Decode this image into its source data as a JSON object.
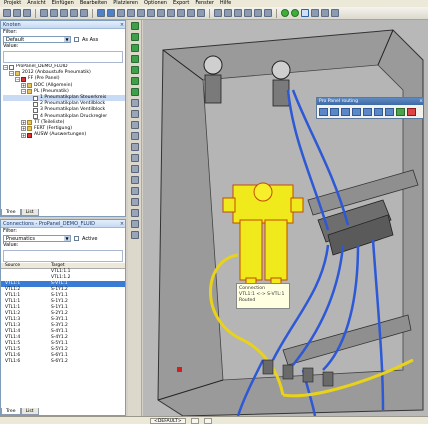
{
  "menu": [
    "Projekt",
    "Ansicht",
    "Einfügen",
    "Bearbeiten",
    "Platzieren",
    "Optionen",
    "Export",
    "Fenster",
    "Hilfe"
  ],
  "nodes_panel": {
    "title": "Knoten",
    "filter_label": "Filter:",
    "filter_value": "Default",
    "checkbox_label": "As Ass",
    "value_label": "Value:",
    "tree": [
      {
        "indent": 0,
        "toggle": "−",
        "icon": "page",
        "text": "ProPanel_DEMO_FLUID"
      },
      {
        "indent": 1,
        "toggle": "−",
        "icon": "folder",
        "text": "2012 (Anbaustufe Pneumatik)"
      },
      {
        "indent": 2,
        "toggle": "−",
        "icon": "red",
        "text": "FF (Pre Panel)"
      },
      {
        "indent": 3,
        "toggle": "+",
        "icon": "folder",
        "text": "DOC (Allgemein)"
      },
      {
        "indent": 3,
        "toggle": "−",
        "icon": "folder",
        "text": "PL (Pneumatik)"
      },
      {
        "indent": 4,
        "toggle": "",
        "icon": "page",
        "text": "1 Pneumatikplan Steuerkreis",
        "hl": true
      },
      {
        "indent": 4,
        "toggle": "",
        "icon": "page",
        "text": "2 Pneumatikplan Ventilblock"
      },
      {
        "indent": 4,
        "toggle": "",
        "icon": "page",
        "text": "3 Pneumatikplan Ventilblock"
      },
      {
        "indent": 4,
        "toggle": "",
        "icon": "page",
        "text": "4 Pneumatikplan Druckregler"
      },
      {
        "indent": 3,
        "toggle": "+",
        "icon": "folder",
        "text": "TT (Teileliste)"
      },
      {
        "indent": 3,
        "toggle": "+",
        "icon": "folder",
        "text": "FERT (Fertigung)"
      },
      {
        "indent": 3,
        "toggle": "+",
        "icon": "red",
        "text": "AUSW (Auswertungen)"
      }
    ],
    "tabs": [
      "Tree",
      "List"
    ]
  },
  "connections_panel": {
    "title": "Connections - ProPanel_DEMO_FLUID",
    "filter_label": "Filter:",
    "filter_value": "Pneumatics",
    "checkbox_label": "Active",
    "value_label": "Value:",
    "columns": [
      "Source",
      "Target"
    ],
    "rows": [
      {
        "source": "",
        "target": "VTL1:1.1"
      },
      {
        "source": "",
        "target": "VTL1:1.2"
      },
      {
        "source": "VTL1:1",
        "target": "S-VTL:1",
        "selected": true
      },
      {
        "source": "VTL1:2",
        "target": "S-1Y1.2"
      },
      {
        "source": "VTL1:1",
        "target": "S-1Y1.1"
      },
      {
        "source": "VTL1:1",
        "target": "S-1Y1.2"
      },
      {
        "source": "VTL1:1",
        "target": "S-1Y1.1"
      },
      {
        "source": "VTL1:2",
        "target": "S-2Y1.2"
      },
      {
        "source": "VTL1:3",
        "target": "S-3Y1.1"
      },
      {
        "source": "VTL1:3",
        "target": "S-3Y1.2"
      },
      {
        "source": "VTL1:4",
        "target": "S-4Y1.1"
      },
      {
        "source": "VTL1:4",
        "target": "S-4Y1.2"
      },
      {
        "source": "VTL1:5",
        "target": "S-5Y1.1"
      },
      {
        "source": "VTL1:5",
        "target": "S-5Y1.2"
      },
      {
        "source": "VTL1:6",
        "target": "S-6Y1.1"
      },
      {
        "source": "VTL1:6",
        "target": "S-6Y1.2"
      }
    ],
    "tabs": [
      "Tree",
      "List"
    ]
  },
  "float_toolbar": {
    "title": "Pro Panel routing"
  },
  "tooltip": {
    "line1": "Connection",
    "line2": "VTL1:1 <-> S-VTL:1",
    "line3": "Routed"
  },
  "status": {
    "field1": "<DEFAULT>",
    "field2": "",
    "field3": ""
  }
}
